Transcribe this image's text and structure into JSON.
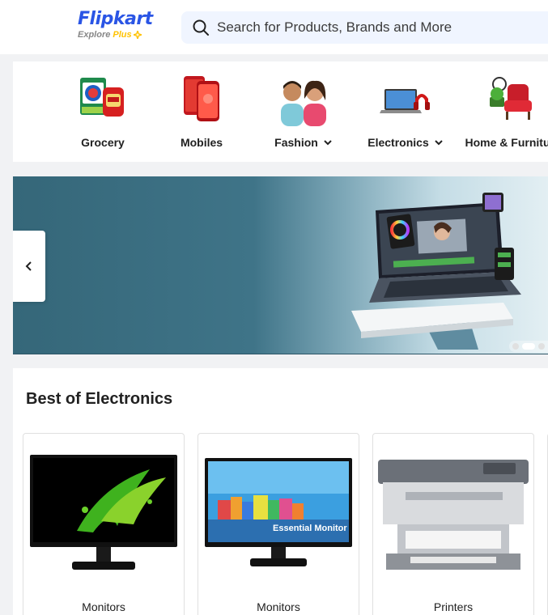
{
  "header": {
    "logo_text": "Flipkart",
    "logo_sub_text": "Explore",
    "logo_plus_text": "Plus",
    "search_placeholder": "Search for Products, Brands and More",
    "brand_color": "#2a55e5",
    "accent_color": "#ffc200"
  },
  "categories": [
    {
      "label": "Grocery",
      "icon": "grocery-icon",
      "has_dropdown": false
    },
    {
      "label": "Mobiles",
      "icon": "mobiles-icon",
      "has_dropdown": false
    },
    {
      "label": "Fashion",
      "icon": "fashion-icon",
      "has_dropdown": true
    },
    {
      "label": "Electronics",
      "icon": "electronics-icon",
      "has_dropdown": true
    },
    {
      "label": "Home & Furnitu",
      "icon": "home-furniture-icon",
      "has_dropdown": false
    }
  ],
  "banner": {
    "prev_icon": "chevron-left-icon",
    "slide_count": 4,
    "active_slide": 2
  },
  "best_of_electronics": {
    "title": "Best of Electronics",
    "products": [
      {
        "label": "Monitors"
      },
      {
        "label": "Monitors",
        "screen_text": "Essential Monitor"
      },
      {
        "label": "Printers"
      }
    ]
  }
}
